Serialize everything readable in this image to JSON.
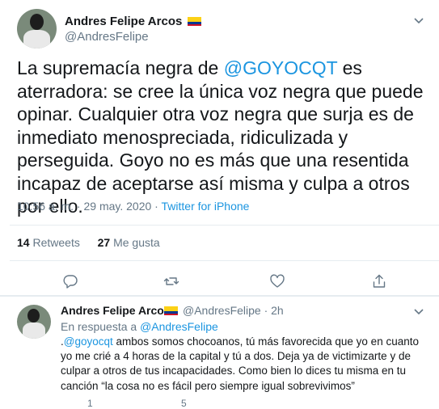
{
  "main_tweet": {
    "author_name": "Andres Felipe Arcos",
    "author_handle": "@AndresFelipe",
    "text_before": "La supremacía negra de ",
    "mention": "@GOYOCQT",
    "text_after": " es aterradora: se cree la única voz negra que puede opinar. Cualquier otra voz negra que surja es de inmediato menospreciada, ridiculizada y perseguida. Goyo no es más que una resentida incapaz de aceptarse así misma y culpa a otros por ello.",
    "time": "10:56 a. m.",
    "sep": " · ",
    "date": "29 may. 2020",
    "source": "Twitter for iPhone",
    "retweets_count": "14",
    "retweets_label": "Retweets",
    "likes_count": "27",
    "likes_label": "Me gusta"
  },
  "reply_tweet": {
    "author_name": "Andres Felipe Arcos",
    "author_handle": "@AndresFelipe",
    "time_ago": "· 2h",
    "in_reply_label": "En respuesta a ",
    "in_reply_handle": "@AndresFelipe",
    "text_prefix": ".",
    "mention": "@goyocqt",
    "text_after": " ambos somos chocoanos, tú más favorecida que yo en cuanto yo me crié a 4 horas de la capital y tú a dos. Deja ya de victimizarte y de culpar a otros de tus incapacidades. Como bien lo dices tu misma en tu canción “la cosa no es fácil pero siempre igual sobrevivimos”",
    "reply_count": "1",
    "retweet_count": "5"
  },
  "icons": {
    "flag": "colombia-flag-icon",
    "caret": "chevron-down-icon",
    "reply": "reply-icon",
    "retweet": "retweet-icon",
    "like": "heart-icon",
    "share": "share-icon"
  },
  "colors": {
    "link": "#1b95e0",
    "muted": "#657786",
    "text": "#14171a",
    "border": "#e6ecf0"
  }
}
